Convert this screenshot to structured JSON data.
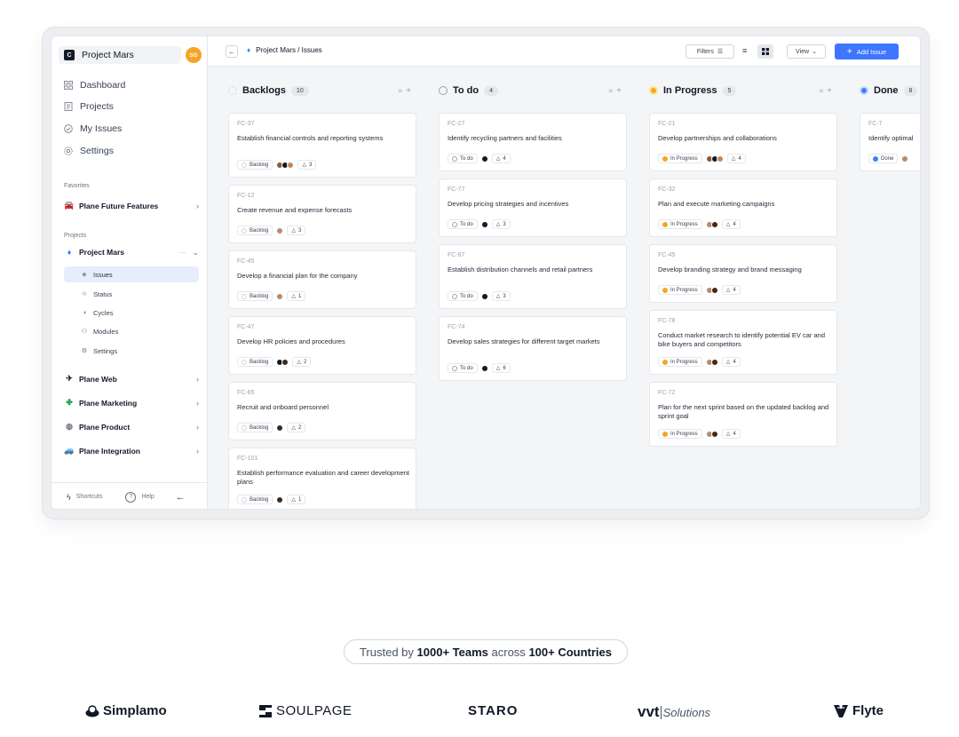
{
  "workspace": {
    "name": "Project Mars",
    "logo_letter": "C",
    "user_initials": "SG"
  },
  "nav": [
    {
      "label": "Dashboard",
      "icon": "grid-icon"
    },
    {
      "label": "Projects",
      "icon": "document-icon"
    },
    {
      "label": "My Issues",
      "icon": "check-circle-icon"
    },
    {
      "label": "Settings",
      "icon": "gear-icon"
    }
  ],
  "favorites": {
    "label": "Favorites",
    "items": [
      {
        "label": "Plane Future Features"
      }
    ]
  },
  "projects": {
    "label": "Projects",
    "active": {
      "label": "Project Mars",
      "more": "···"
    },
    "subs": [
      {
        "label": "Issues"
      },
      {
        "label": "Status"
      },
      {
        "label": "Cycles"
      },
      {
        "label": "Modules"
      },
      {
        "label": "Settings"
      }
    ],
    "others": [
      {
        "label": "Plane Web"
      },
      {
        "label": "Plane Marketing"
      },
      {
        "label": "Plane Product"
      },
      {
        "label": "Plane Integration"
      }
    ]
  },
  "footer": {
    "shortcuts": "Shortcuts",
    "help": "Help"
  },
  "topbar": {
    "breadcrumb": "Project Mars / Issues",
    "filters": "Filters",
    "view": "View",
    "add_issue": "Add Issue"
  },
  "columns": [
    {
      "name": "Backlogs",
      "count": "10",
      "state": "Backlog",
      "color": "#d1d5db",
      "cards": [
        {
          "id": "FC-37",
          "title": "Establish financial controls and reporting systems",
          "priority": "3"
        },
        {
          "id": "FC-12",
          "title": "Create revenue and expense forecasts",
          "priority": "3"
        },
        {
          "id": "FC-45",
          "title": "Develop a financial plan for the company",
          "priority": "1"
        },
        {
          "id": "FC-47",
          "title": "Develop HR policies and procedures",
          "priority": "2"
        },
        {
          "id": "FC-65",
          "title": "Recruit and onboard personnel",
          "priority": "2"
        },
        {
          "id": "FC-101",
          "title": "Establish performance evaluation and career development plans",
          "priority": "1"
        }
      ]
    },
    {
      "name": "To do",
      "count": "4",
      "state": "To do",
      "color": "#9ca3af",
      "cards": [
        {
          "id": "FC-27",
          "title": "Identify recycling partners and facilities",
          "priority": "4"
        },
        {
          "id": "FC-77",
          "title": "Develop pricing strategies and incentives",
          "priority": "3"
        },
        {
          "id": "FC-67",
          "title": "Establish distribution channels and retail partners",
          "priority": "3"
        },
        {
          "id": "FC-74",
          "title": "Develop sales strategies for different target markets",
          "priority": "6"
        }
      ]
    },
    {
      "name": "In Progress",
      "count": "5",
      "state": "In Progress",
      "color": "#f5a524",
      "cards": [
        {
          "id": "FC-21",
          "title": "Develop partnerships and collaborations",
          "priority": "4"
        },
        {
          "id": "FC-32",
          "title": "Plan and execute marketing campaigns",
          "priority": "4"
        },
        {
          "id": "FC-45",
          "title": "Develop branding strategy and brand messaging",
          "priority": "4"
        },
        {
          "id": "FC-78",
          "title": "Conduct market research to identify potential EV car and bike buyers and competitors",
          "priority": "4"
        },
        {
          "id": "FC-72",
          "title": "Plan for the next sprint based on the updated backlog and sprint goal",
          "priority": "4"
        }
      ]
    },
    {
      "name": "Done",
      "count": "8",
      "state": "Done",
      "color": "#3b82f6",
      "cards": [
        {
          "id": "FC-7",
          "title": "Identify optimal",
          "priority": ""
        }
      ]
    }
  ],
  "trusted": {
    "pre": "Trusted by",
    "teams": "1000+ Teams",
    "mid": "across",
    "countries": "100+ Countries"
  },
  "logos": [
    "Simplamo",
    "SOULPAGE",
    "STARO",
    "Solutions",
    "Flyte"
  ],
  "logo_vvt": "vvt"
}
